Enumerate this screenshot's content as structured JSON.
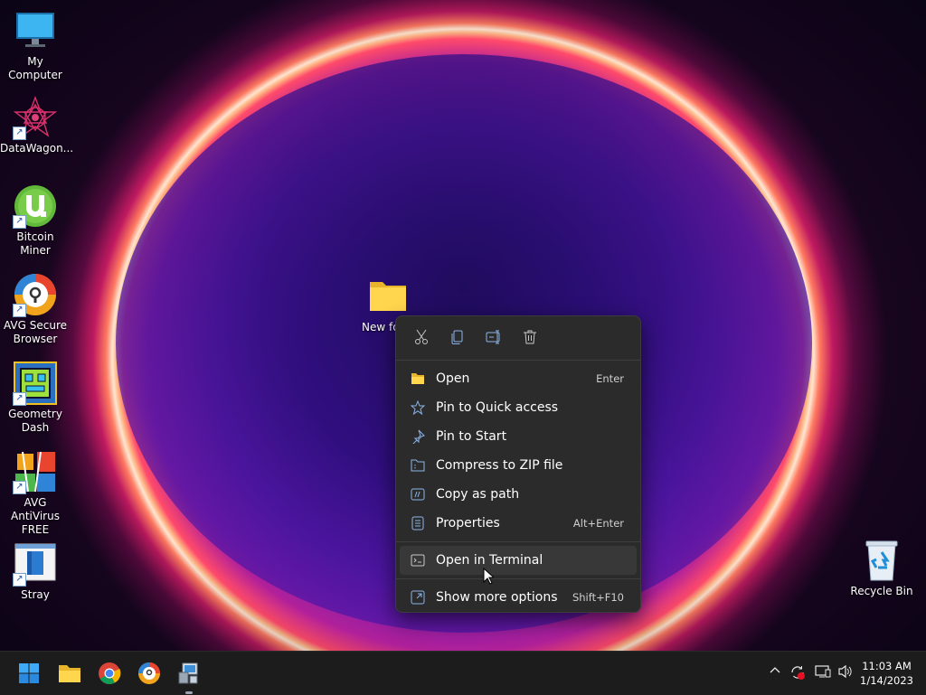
{
  "desktop_icons": [
    {
      "label": "My Computer"
    },
    {
      "label": "DataWagon..."
    },
    {
      "label": "Bitcoin Miner"
    },
    {
      "label": "AVG Secure Browser"
    },
    {
      "label": "Geometry Dash"
    },
    {
      "label": "AVG AntiVirus FREE"
    },
    {
      "label": "Stray"
    },
    {
      "label": "Recycle Bin"
    }
  ],
  "folder": {
    "label": "New fo"
  },
  "context_menu": {
    "quick_actions": [
      {
        "icon": "cut-icon"
      },
      {
        "icon": "copy-icon"
      },
      {
        "icon": "rename-icon"
      },
      {
        "icon": "delete-icon"
      }
    ],
    "items": [
      {
        "label": "Open",
        "shortcut": "Enter",
        "icon": "folder-icon"
      },
      {
        "label": "Pin to Quick access",
        "shortcut": "",
        "icon": "star-icon"
      },
      {
        "label": "Pin to Start",
        "shortcut": "",
        "icon": "pin-icon"
      },
      {
        "label": "Compress to ZIP file",
        "shortcut": "",
        "icon": "zip-icon"
      },
      {
        "label": "Copy as path",
        "shortcut": "",
        "icon": "path-icon"
      },
      {
        "label": "Properties",
        "shortcut": "Alt+Enter",
        "icon": "properties-icon"
      },
      {
        "label": "Open in Terminal",
        "shortcut": "",
        "icon": "terminal-icon"
      },
      {
        "label": "Show more options",
        "shortcut": "Shift+F10",
        "icon": "more-options-icon"
      }
    ]
  },
  "taskbar": {
    "apps": [
      {
        "name": "start-button"
      },
      {
        "name": "file-explorer"
      },
      {
        "name": "chrome"
      },
      {
        "name": "avg-secure-browser"
      },
      {
        "name": "setup-app"
      }
    ],
    "clock": {
      "time": "11:03 AM",
      "date": "1/14/2023"
    }
  },
  "colors": {
    "menu_bg": "#2b2b2b",
    "taskbar_bg": "#1c1c1c",
    "accent": "#0078d4"
  }
}
